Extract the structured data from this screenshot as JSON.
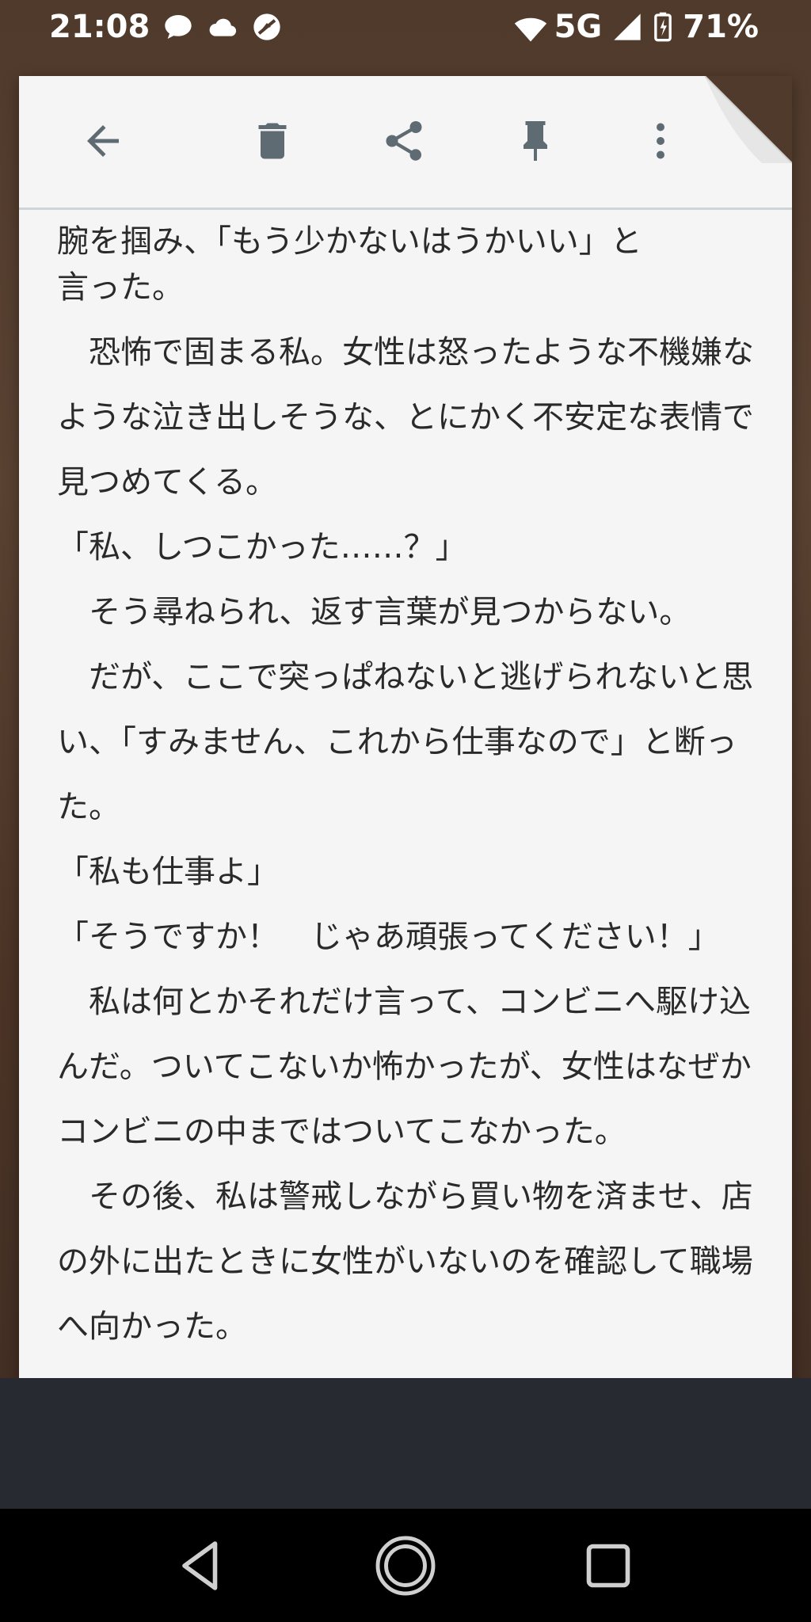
{
  "status_bar": {
    "time": "21:08",
    "left_icons": [
      "chat-bubble-icon",
      "cloud-icon",
      "no-sound-icon"
    ],
    "network": "5G",
    "battery": "71%"
  },
  "toolbar": {
    "buttons": [
      "back-arrow-icon",
      "trash-icon",
      "share-icon",
      "pin-icon",
      "more-vert-icon"
    ]
  },
  "note": {
    "partial_top_line": "腕を掴み、「もう少かないはうかいい」と",
    "paragraphs": [
      "言った。",
      "　恐怖で固まる私。女性は怒ったような不機嫌なような泣き出しそうな、とにかく不安定な表情で見つめてくる。",
      "「私、しつこかった……？」",
      "　そう尋ねられ、返す言葉が見つからない。",
      "　だが、ここで突っぱねないと逃げられないと思い、「すみません、これから仕事なので」と断った。",
      "「私も仕事よ」",
      "「そうですか！　じゃあ頑張ってください！」",
      "　私は何とかそれだけ言って、コンビニへ駆け込んだ。ついてこないか怖かったが、女性はなぜかコンビニの中まではついてこなかった。",
      "　その後、私は警戒しながら買い物を済ませ、店の外に出たときに女性がいないのを確認して職場へ向かった。"
    ]
  },
  "colors": {
    "card_bg": "#f5f5f5",
    "icon_gray": "#5f6b73",
    "text": "#2a2a2a",
    "wallpaper": "#4f3a2b",
    "nav_bg": "#000000"
  },
  "nav_bar": {
    "buttons": [
      "back-triangle-icon",
      "home-circle-icon",
      "recents-square-icon"
    ]
  }
}
